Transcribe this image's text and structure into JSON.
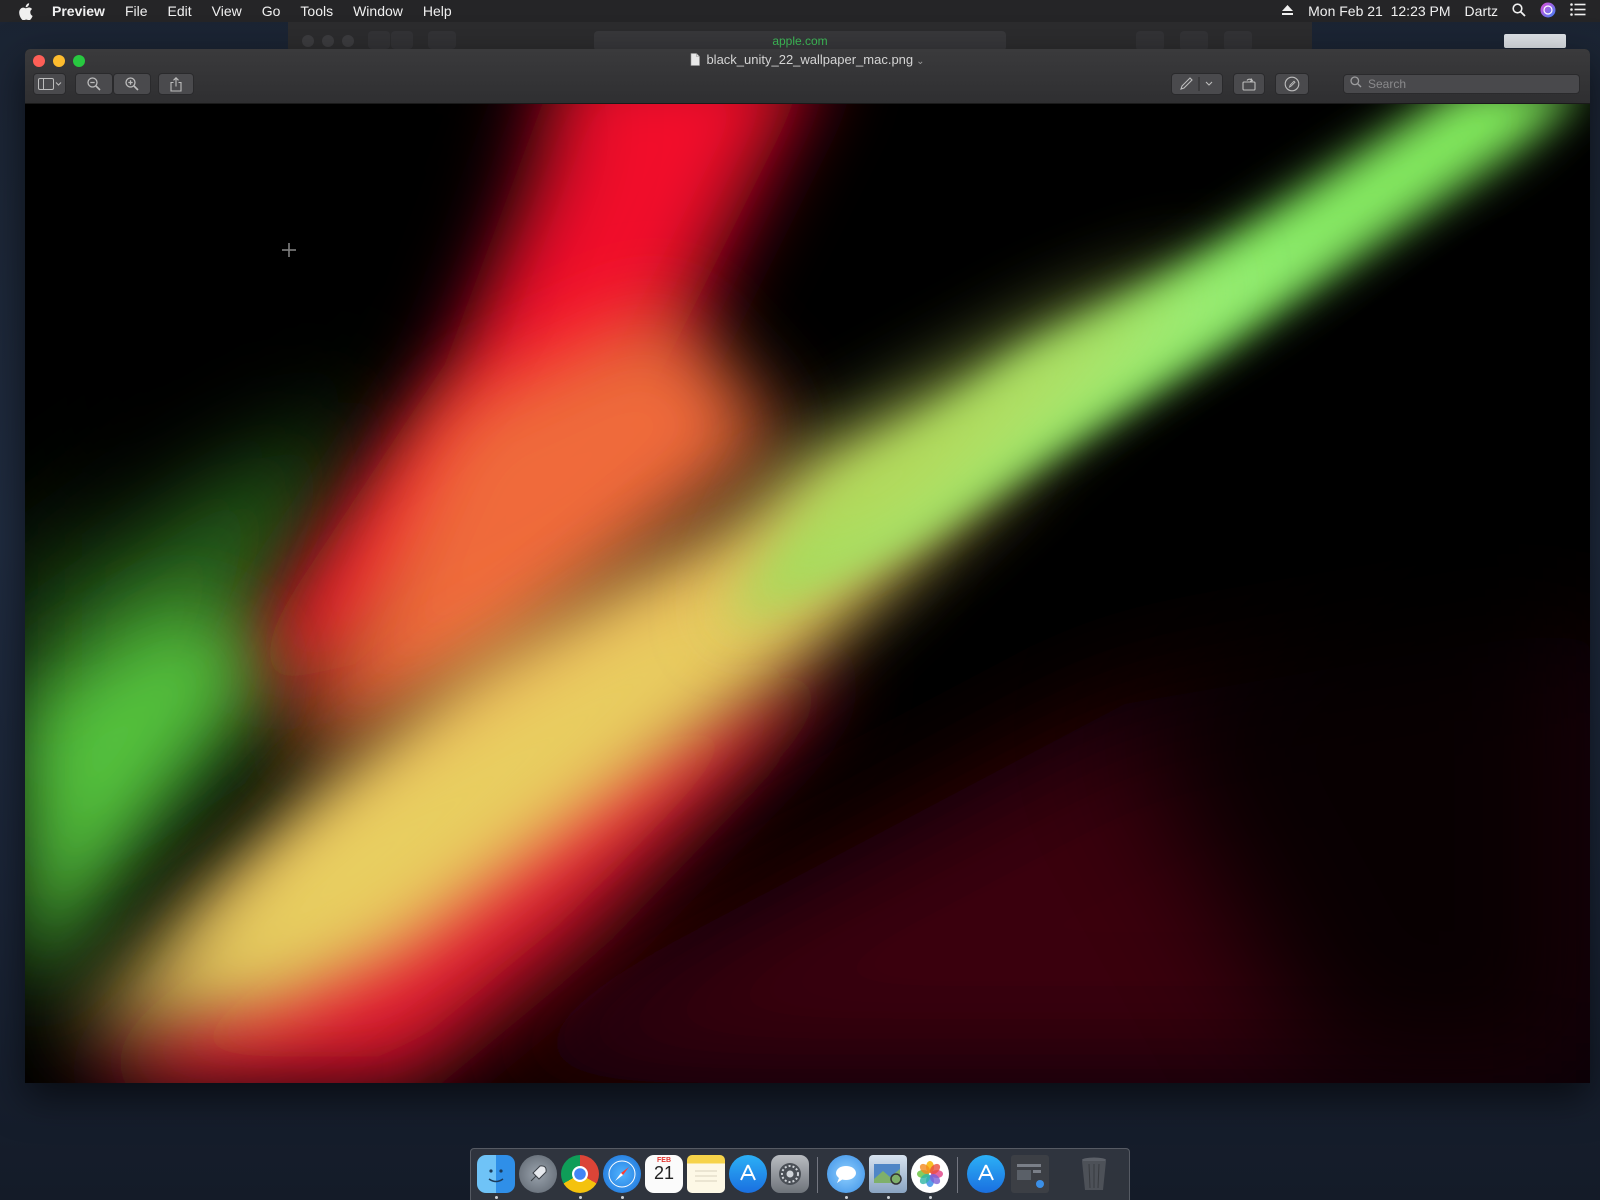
{
  "menubar": {
    "app_name": "Preview",
    "items": [
      "File",
      "Edit",
      "View",
      "Go",
      "Tools",
      "Window",
      "Help"
    ],
    "datetime": "Mon Feb 21  12:23 PM",
    "user": "Dartz",
    "icons": [
      "apple-icon",
      "eject-icon",
      "spotlight-icon",
      "siri-icon",
      "notification-center-icon"
    ]
  },
  "safari": {
    "url": "apple.com"
  },
  "preview": {
    "filename": "black_unity_22_wallpaper_mac.png",
    "search_placeholder": "Search",
    "toolbar_icons": [
      "sidebar-icon",
      "zoom-out-icon",
      "zoom-in-icon",
      "share-icon",
      "markup-pen-icon",
      "rotate-icon",
      "markup-toolbar-icon",
      "search-icon"
    ]
  },
  "dock": {
    "calendar_month": "FEB",
    "calendar_day": "21",
    "apps": [
      "Finder",
      "Launchpad",
      "Google Chrome",
      "Safari",
      "Calendar",
      "Notes",
      "App Store",
      "System Preferences",
      "Messages",
      "Preview",
      "Photos",
      "Downloads",
      "Screenshot",
      "Trash"
    ]
  },
  "colors": {
    "red": "#f2102b",
    "orange": "#f0663a",
    "yellow": "#e8d060",
    "green": "#5fd64a",
    "accent_url": "#3fc05a"
  }
}
